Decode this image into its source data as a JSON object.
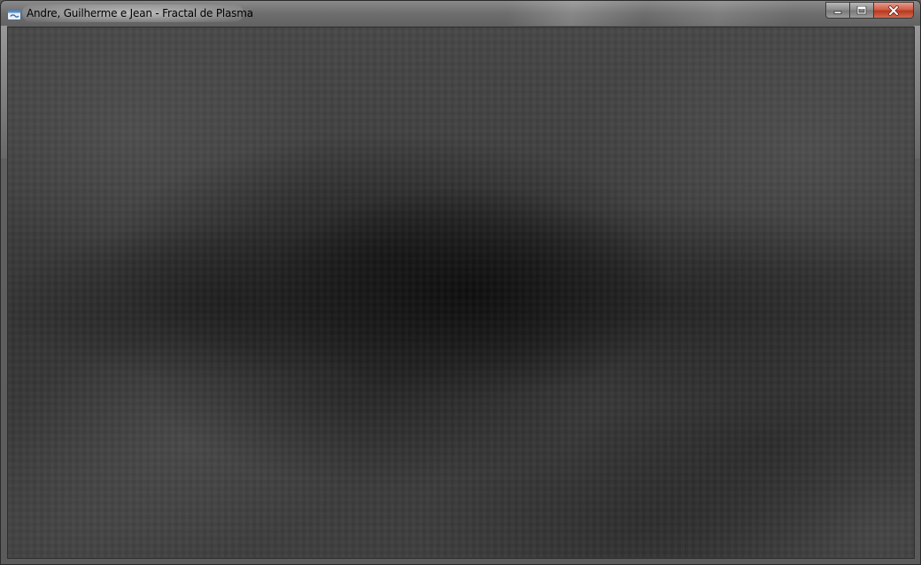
{
  "window": {
    "title": "Andre, Guilherme e Jean - Fractal de Plasma",
    "app_icon": "app-window-icon",
    "caption_buttons": {
      "minimize_icon": "minimize-icon",
      "maximize_icon": "maximize-icon",
      "close_icon": "close-icon"
    }
  },
  "canvas": {
    "content": "plasma-fractal",
    "palette": [
      "#111111",
      "#2a2a2a",
      "#3a3a3a",
      "#4a4a4a",
      "#565656"
    ]
  },
  "colors": {
    "titlebar": "#6e6e6e",
    "close_button": "#c94a33",
    "border": "#2a2a2a"
  }
}
